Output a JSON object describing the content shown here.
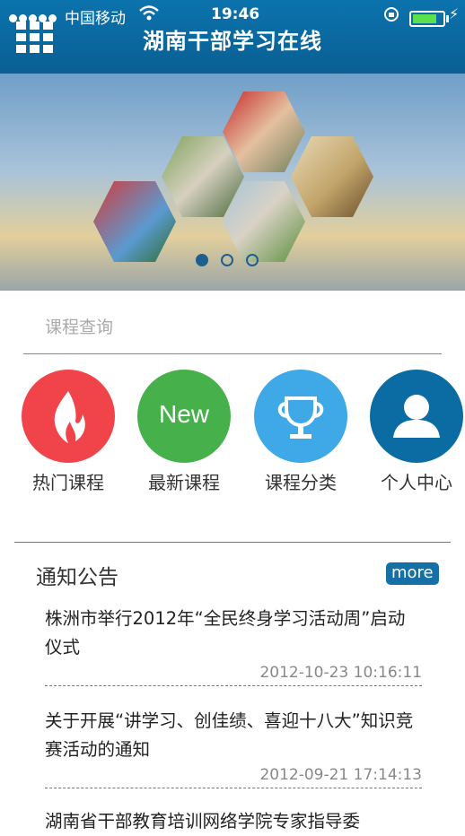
{
  "status_bar": {
    "carrier": "中国移动",
    "time": "19:46"
  },
  "header": {
    "title": "湖南干部学习在线"
  },
  "banner": {
    "active_slide": 1,
    "slide_count": 3
  },
  "search": {
    "placeholder": "课程查询"
  },
  "nav": [
    {
      "label": "热门课程",
      "color": "#f0434a",
      "icon": "flame-icon"
    },
    {
      "label": "最新课程",
      "color": "#46b04a",
      "icon": "new-badge-icon",
      "icon_text": "New"
    },
    {
      "label": "课程分类",
      "color": "#3fa8e6",
      "icon": "trophy-icon"
    },
    {
      "label": "个人中心",
      "color": "#0b6ba3",
      "icon": "person-icon"
    }
  ],
  "notices": {
    "title": "通知公告",
    "more_label": "more",
    "items": [
      {
        "title": "株洲市举行2012年“全民终身学习活动周”启动仪式",
        "date": "2012-10-23 10:16:11"
      },
      {
        "title": "关于开展“讲学习、创佳绩、喜迎十八大”知识竞赛活动的通知",
        "date": "2012-09-21 17:14:13"
      },
      {
        "title": "湖南省干部教育培训网络学院专家指导委",
        "date": ""
      }
    ]
  }
}
